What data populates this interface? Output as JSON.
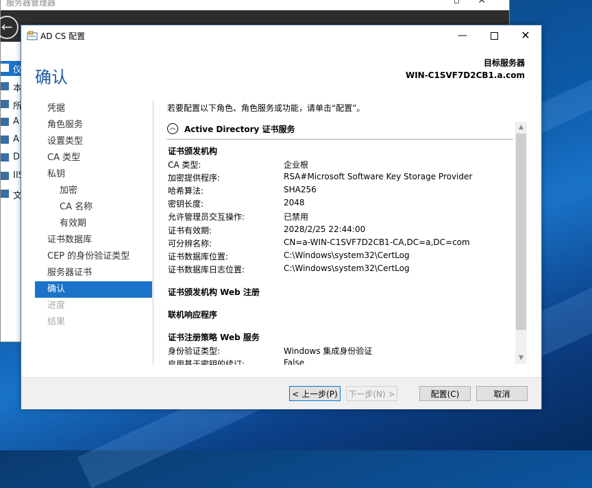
{
  "background_window": {
    "title": "服务器管理器",
    "sidebar_items": [
      "仪",
      "本",
      "所",
      "A",
      "A",
      "D",
      "IIS",
      "文"
    ]
  },
  "dialog": {
    "title": "AD CS 配置",
    "page_title": "确认",
    "target_label": "目标服务器",
    "target_value": "WIN-C1SVF7D2CB1.a.com"
  },
  "nav": {
    "items": [
      {
        "label": "凭据",
        "state": "normal"
      },
      {
        "label": "角色服务",
        "state": "normal"
      },
      {
        "label": "设置类型",
        "state": "normal"
      },
      {
        "label": "CA 类型",
        "state": "normal"
      },
      {
        "label": "私钥",
        "state": "normal"
      },
      {
        "label": "加密",
        "state": "sub"
      },
      {
        "label": "CA 名称",
        "state": "sub"
      },
      {
        "label": "有效期",
        "state": "sub"
      },
      {
        "label": "证书数据库",
        "state": "normal"
      },
      {
        "label": "CEP 的身份验证类型",
        "state": "normal"
      },
      {
        "label": "服务器证书",
        "state": "normal"
      },
      {
        "label": "确认",
        "state": "active"
      },
      {
        "label": "进度",
        "state": "disabled"
      },
      {
        "label": "结果",
        "state": "disabled"
      }
    ]
  },
  "content": {
    "intro": "若要配置以下角色、角色服务或功能，请单击“配置”。",
    "section_title": "Active Directory 证书服务",
    "groups": [
      {
        "title": "证书颁发机构",
        "rows": [
          {
            "key": "CA 类型:",
            "value": "企业根"
          },
          {
            "key": "加密提供程序:",
            "value": "RSA#Microsoft Software Key Storage Provider"
          },
          {
            "key": "哈希算法:",
            "value": "SHA256"
          },
          {
            "key": "密钥长度:",
            "value": "2048"
          },
          {
            "key": "允许管理员交互操作:",
            "value": "已禁用"
          },
          {
            "key": "证书有效期:",
            "value": "2028/2/25 22:44:00"
          },
          {
            "key": "可分辨名称:",
            "value": "CN=a-WIN-C1SVF7D2CB1-CA,DC=a,DC=com"
          },
          {
            "key": "证书数据库位置:",
            "value": "C:\\Windows\\system32\\CertLog"
          },
          {
            "key": "证书数据库日志位置:",
            "value": "C:\\Windows\\system32\\CertLog"
          }
        ]
      },
      {
        "title": "证书颁发机构 Web 注册",
        "rows": []
      },
      {
        "title": "联机响应程序",
        "rows": []
      },
      {
        "title": "证书注册策略 Web 服务",
        "rows": [
          {
            "key": "身份验证类型:",
            "value": "Windows 集成身份验证"
          },
          {
            "key": "启用基于密钥的续订:",
            "value": "False"
          }
        ]
      }
    ]
  },
  "footer": {
    "prev": "< 上一步(P)",
    "next": "下一步(N) >",
    "configure": "配置(C)",
    "cancel": "取消"
  }
}
